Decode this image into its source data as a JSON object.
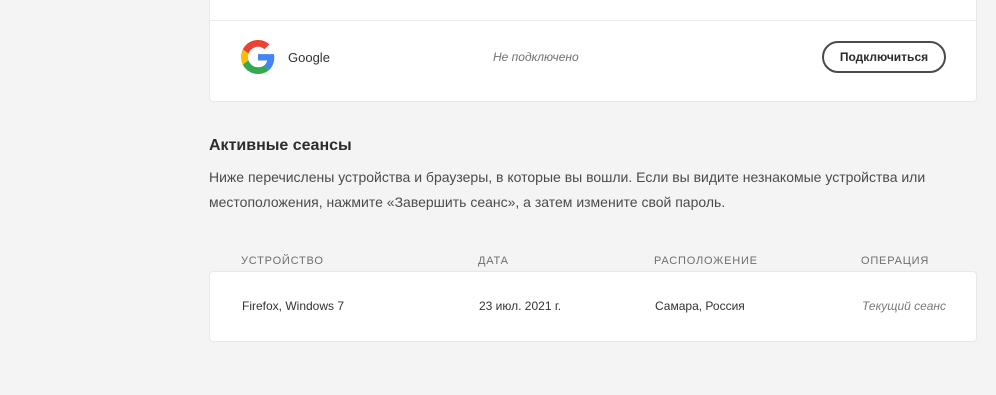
{
  "linked_accounts": {
    "google": {
      "name": "Google",
      "status": "Не подключено",
      "action_label": "Подключиться",
      "icon": "google-logo-icon",
      "colors": {
        "blue": "#4285F4",
        "red": "#EA4335",
        "yellow": "#FBBC05",
        "green": "#34A853"
      }
    }
  },
  "active_sessions": {
    "title": "Активные сеансы",
    "description": "Ниже перечислены устройства и браузеры, в которые вы вошли. Если вы видите незнакомые устройства или местоположения, нажмите «Завершить сеанс», а затем измените свой пароль.",
    "columns": [
      "УСТРОЙСТВО",
      "ДАТА",
      "РАСПОЛОЖЕНИЕ",
      "ОПЕРАЦИЯ"
    ],
    "rows": [
      {
        "device": "Firefox, Windows 7",
        "date": "23 июл. 2021 г.",
        "location": "Самара, Россия",
        "operation": "Текущий сеанс"
      }
    ]
  }
}
